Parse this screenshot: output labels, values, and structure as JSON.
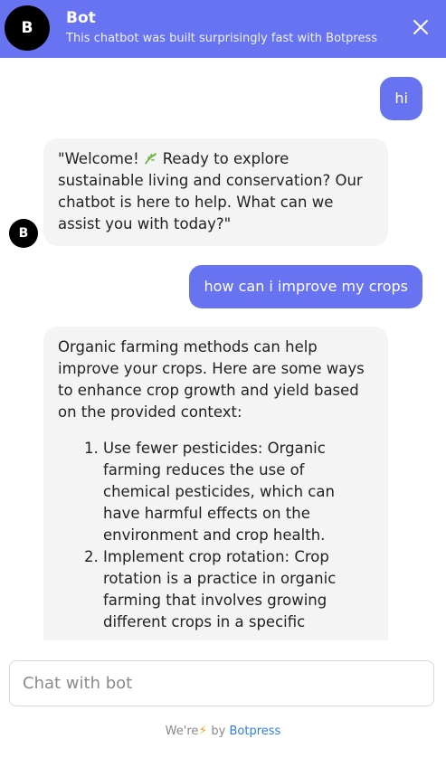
{
  "header": {
    "avatar_letter": "B",
    "title": "Bot",
    "subtitle": "This chatbot was built surprisingly fast with Botpress",
    "close_icon": "close-icon"
  },
  "conversation": {
    "bot_avatar_letter": "B",
    "messages": [
      {
        "from": "user",
        "text": "hi"
      },
      {
        "from": "bot",
        "text_before_icon": "\"Welcome!",
        "icon": "leaf-icon",
        "text_after_icon": "Ready to explore sustainable living and conservation? Our chatbot is here to help. What can we assist you with today?\""
      },
      {
        "from": "user",
        "text": "how can i improve my crops"
      },
      {
        "from": "bot",
        "intro": "Organic farming methods can help improve your crops. Here are some ways to enhance crop growth and yield based on the provided context:",
        "list": [
          "Use fewer pesticides: Organic farming reduces the use of chemical pesticides, which can have harmful effects on the environment and crop health.",
          "Implement crop rotation: Crop rotation is a practice in organic farming that involves growing different crops in a specific"
        ]
      }
    ]
  },
  "composer": {
    "placeholder": "Chat with bot"
  },
  "footer": {
    "prefix": "We're",
    "icon": "lightning-icon",
    "by": "by",
    "brand": "Botpress"
  },
  "colors": {
    "accent": "#6873f2",
    "bubble_bot": "#f4f4f4",
    "brand_link": "#2f7de1",
    "bolt": "#f5a623"
  }
}
